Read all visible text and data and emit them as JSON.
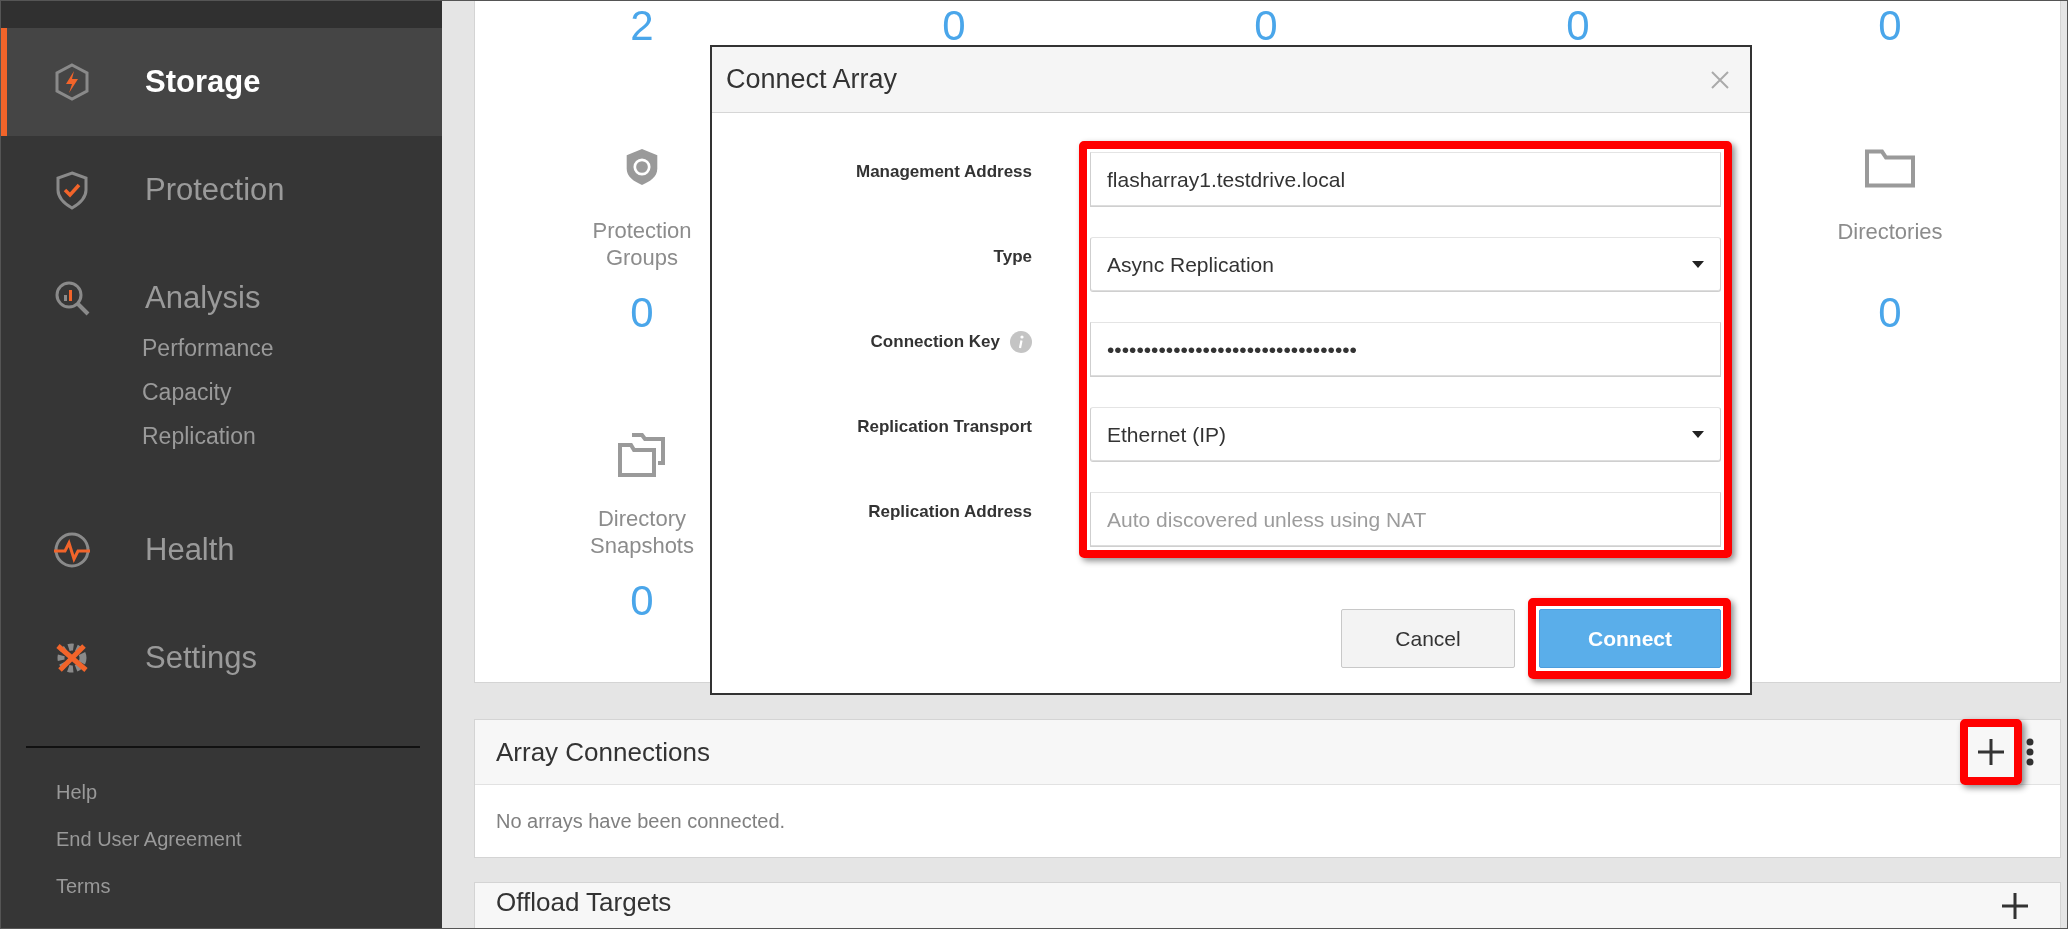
{
  "sidebar": {
    "nav": [
      {
        "label": "Storage",
        "kind": "storage",
        "selected": true
      },
      {
        "label": "Protection",
        "kind": "protection",
        "selected": false
      },
      {
        "label": "Analysis",
        "kind": "analysis",
        "selected": false,
        "children": [
          {
            "label": "Performance"
          },
          {
            "label": "Capacity"
          },
          {
            "label": "Replication"
          }
        ]
      },
      {
        "label": "Health",
        "kind": "health",
        "selected": false
      },
      {
        "label": "Settings",
        "kind": "settings",
        "selected": false
      }
    ],
    "footer_links": [
      "Help",
      "End User Agreement",
      "Terms"
    ]
  },
  "summary": {
    "top_counts": [
      "2",
      "0",
      "0",
      "0",
      "0"
    ],
    "rows": [
      [
        {
          "label": "Protection Groups",
          "count": "0",
          "kind": "shield"
        },
        null,
        null,
        null,
        {
          "label": "Directories",
          "count": "0",
          "kind": "folder"
        }
      ],
      [
        {
          "label": "Directory Snapshots",
          "count": "0",
          "kind": "folders"
        }
      ]
    ]
  },
  "dialog": {
    "title": "Connect Array",
    "fields_highlighted": true,
    "fields": [
      {
        "label": "Management Address",
        "kind": "text",
        "value": "flasharray1.testdrive.local"
      },
      {
        "label": "Type",
        "kind": "select",
        "value": "Async Replication"
      },
      {
        "label": "Connection Key",
        "kind": "text",
        "info": true,
        "value": "••••••••••••••••••••••••••••••••••"
      },
      {
        "label": "Replication Transport",
        "kind": "select",
        "value": "Ethernet (IP)"
      },
      {
        "label": "Replication Address",
        "kind": "text",
        "placeholder": "Auto discovered unless using NAT"
      }
    ],
    "buttons": [
      {
        "label": "Cancel",
        "kind": "secondary",
        "highlighted": false
      },
      {
        "label": "Connect",
        "kind": "primary",
        "highlighted": true
      }
    ]
  },
  "panels": [
    {
      "title": "Array Connections",
      "message": "No arrays have been connected.",
      "add_highlighted": true,
      "menu": true
    },
    {
      "title": "Offload Targets",
      "add_highlighted": false,
      "menu": false
    }
  ]
}
